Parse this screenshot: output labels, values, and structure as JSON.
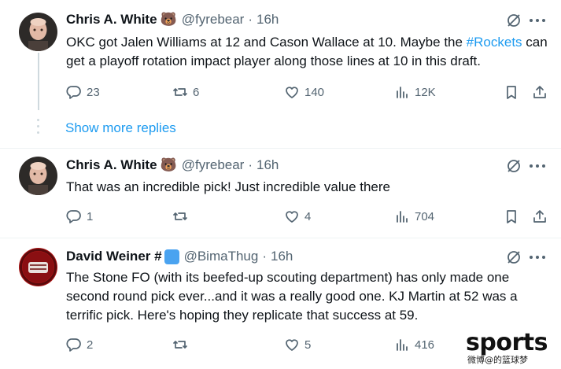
{
  "tweets": [
    {
      "name": "Chris A. White",
      "emoji": "🐻",
      "handle": "@fyrebear",
      "time": "16h",
      "text_before": "OKC got Jalen Williams at 12 and Cason Wallace at 10. Maybe the ",
      "hashtag": "#Rockets",
      "text_after": " can get a playoff rotation impact player along those lines at 10 in this draft.",
      "replies": "23",
      "reposts": "6",
      "likes": "140",
      "views": "12K"
    },
    {
      "name": "Chris A. White",
      "emoji": "🐻",
      "handle": "@fyrebear",
      "time": "16h",
      "text": "That was an incredible pick! Just incredible value there",
      "replies": "1",
      "reposts": "",
      "likes": "4",
      "views": "704"
    },
    {
      "name": "David Weiner #",
      "handle": "@BimaThug",
      "time": "16h",
      "text": "The Stone FO (with its beefed-up scouting department) has only made one second round pick ever...and it was a really good one. KJ Martin at 52 was a terrific pick. Here's hoping they replicate that success at 59.",
      "replies": "2",
      "reposts": "",
      "likes": "5",
      "views": "416"
    }
  ],
  "show_more_replies": "Show more replies",
  "separator": "·",
  "watermark": "sports",
  "watermark_sub": "微博@的篮球梦",
  "colors": {
    "accent": "#1d9bf0",
    "secondary_text": "#536471",
    "primary_text": "#0f1419",
    "divider": "#eff3f4",
    "thread_line": "#cfd9de"
  }
}
